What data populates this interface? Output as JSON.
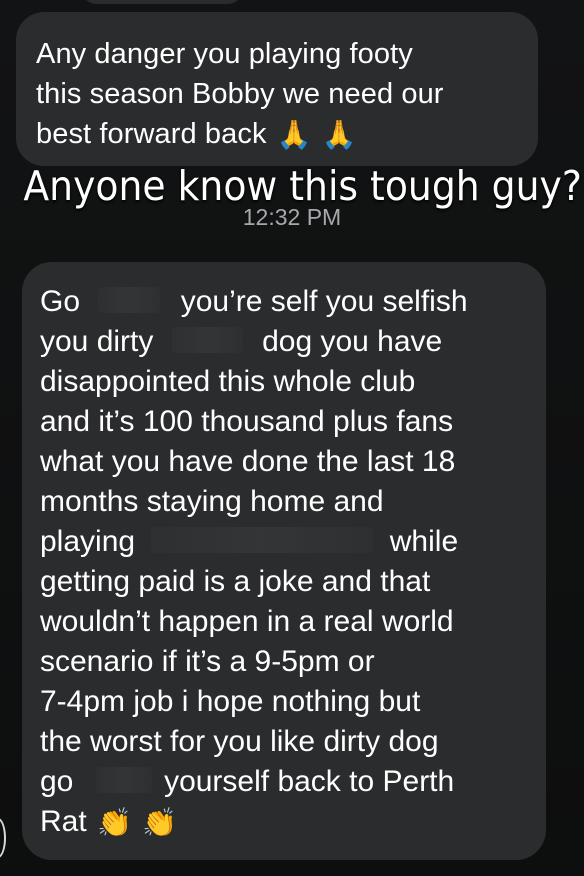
{
  "messages": [
    {
      "lines": [
        "Any danger you playing footy",
        "this season Bobby we need our",
        "best forward back"
      ],
      "trailing_emoji": [
        "🙏",
        "🙏"
      ]
    },
    {
      "lines": [
        {
          "parts": [
            "Go",
            "[redacted]",
            "you’re self you selfish"
          ]
        },
        {
          "parts": [
            "you dirty",
            "[redacted]",
            "dog you have"
          ]
        },
        {
          "parts": [
            "disappointed this whole club"
          ]
        },
        {
          "parts": [
            "and it’s 100 thousand plus fans"
          ]
        },
        {
          "parts": [
            "what you have done the last 18"
          ]
        },
        {
          "parts": [
            "months staying home and"
          ]
        },
        {
          "parts": [
            "playing",
            "[redacted]",
            "while"
          ]
        },
        {
          "parts": [
            "getting paid is a joke and that"
          ]
        },
        {
          "parts": [
            "wouldn’t happen in a real world"
          ]
        },
        {
          "parts": [
            "scenario if it’s a 9-5pm or"
          ]
        },
        {
          "parts": [
            "7-4pm job i hope nothing but"
          ]
        },
        {
          "parts": [
            "the worst for you like dirty dog"
          ]
        },
        {
          "parts": [
            "go",
            "[redacted]",
            "yourself back to Perth"
          ]
        },
        {
          "parts": [
            "Rat"
          ]
        }
      ],
      "trailing_emoji": [
        "👏",
        "👏"
      ]
    }
  ],
  "story_caption": "Anyone know this tough guy?",
  "timestamp": "12:32 PM",
  "colors": {
    "background": "#0f1010",
    "bubble": "#2b2c2e",
    "text": "#ffffff",
    "timestamp": "#a8a8ac"
  },
  "icons": [
    "folded-hands-emoji",
    "clapping-hands-emoji"
  ]
}
